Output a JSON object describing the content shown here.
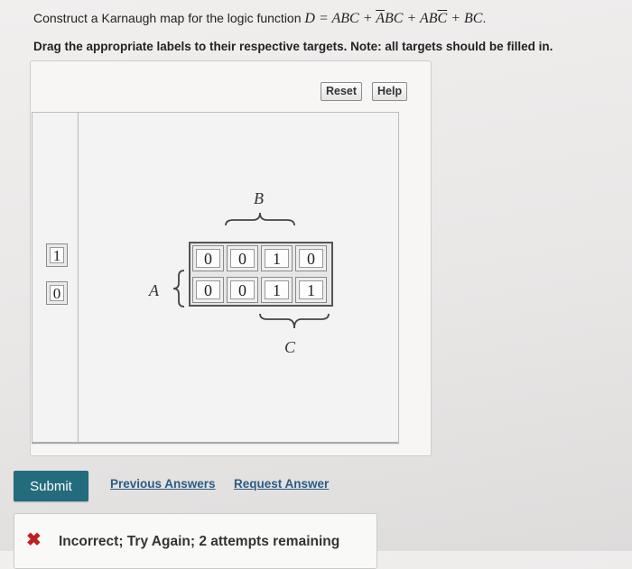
{
  "question": {
    "prefix": "Construct a Karnaugh map for the logic function ",
    "f_lhs": "D",
    "f_eq": " = ",
    "t1": "ABC",
    "plus1": " + ",
    "t2_bar": "A",
    "t2_rest": "BC",
    "plus2": " + ",
    "t3_pre": "AB",
    "t3_bar": "C",
    "plus3": " + ",
    "t4": "BC",
    "period": "."
  },
  "instruction": "Drag the appropriate labels to their respective targets. Note: all targets should be filled in.",
  "toolbar": {
    "reset_label": "Reset",
    "help_label": "Help"
  },
  "palette": {
    "labels": [
      "1",
      "0"
    ]
  },
  "kmap": {
    "var_a": "A",
    "var_b": "B",
    "var_c": "C",
    "row_top": [
      "0",
      "0",
      "1",
      "0"
    ],
    "row_bottom": [
      "0",
      "0",
      "1",
      "1"
    ]
  },
  "actions": {
    "submit_label": "Submit",
    "previous_answers_label": "Previous Answers",
    "request_answer_label": "Request Answer"
  },
  "feedback": {
    "icon": "x-mark-icon",
    "icon_glyph": "✖",
    "icon_color": "#c21f1f",
    "text": "Incorrect; Try Again; 2 attempts remaining"
  },
  "colors": {
    "submit_bg": "#236c7e",
    "link": "#2a5c86"
  }
}
